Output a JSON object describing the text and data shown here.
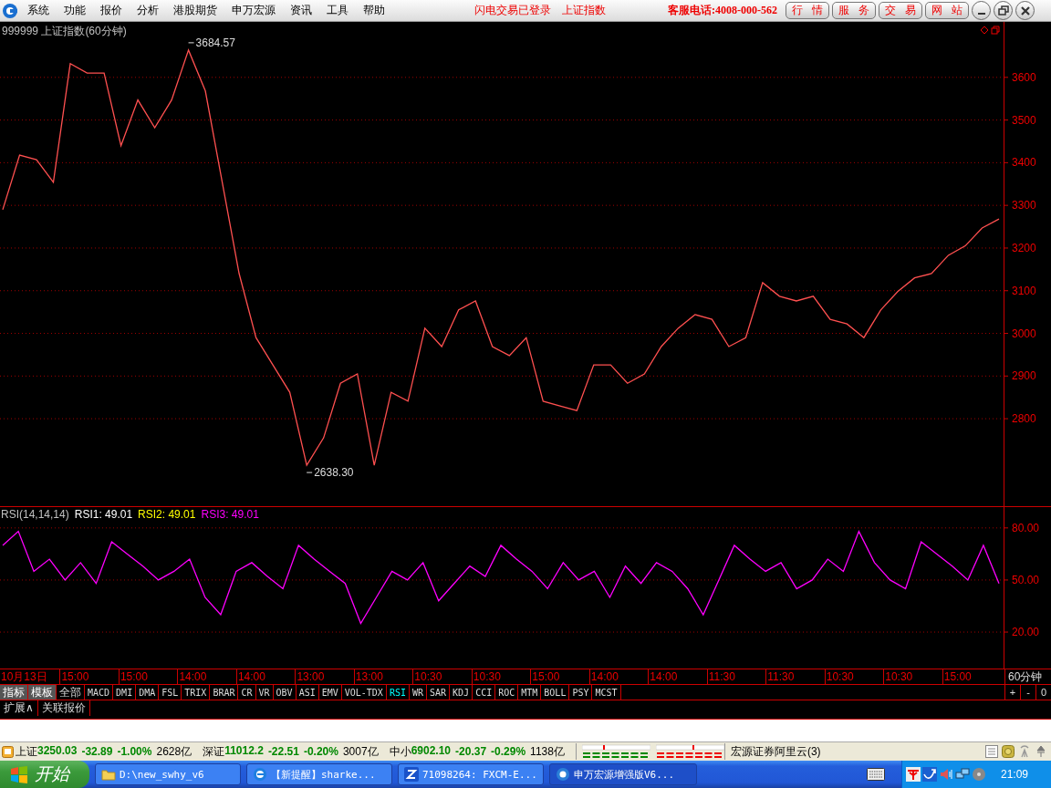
{
  "menu": {
    "items": [
      "系统",
      "功能",
      "报价",
      "分析",
      "港股期货",
      "申万宏源",
      "资讯",
      "工具",
      "帮助"
    ],
    "notice": "闪电交易已登录",
    "index_link": "上证指数",
    "hotline": "客服电话:4008-000-562",
    "buttons": [
      "行情",
      "服务",
      "交易",
      "网站"
    ]
  },
  "price_pane": {
    "title": "999999 上证指数(60分钟)",
    "chart_data": {
      "type": "line",
      "ylim": [
        2595,
        3730
      ],
      "grid": true,
      "yticks": [
        2800,
        2900,
        3000,
        3100,
        3200,
        3300,
        3400,
        3500,
        3600
      ],
      "series": [
        {
          "color": "#ff5050",
          "values": [
            3290,
            3418,
            3407,
            3354,
            3632,
            3610,
            3610,
            3440,
            3547,
            3482,
            3547,
            3664,
            3568,
            3354,
            3140,
            2990,
            2926,
            2862,
            2691,
            2755,
            2883,
            2905,
            2691,
            2862,
            2841,
            3012,
            2969,
            3055,
            3076,
            2969,
            2948,
            2990,
            2841,
            2830,
            2819,
            2926,
            2926,
            2883,
            2905,
            2969,
            3012,
            3044,
            3033,
            2969,
            2990,
            3119,
            3087,
            3076,
            3087,
            3033,
            3022,
            2990,
            3055,
            3098,
            3130,
            3140,
            3183,
            3205,
            3247,
            3268
          ]
        }
      ],
      "annotations": [
        {
          "text": "3684.57"
        },
        {
          "text": "2638.30"
        }
      ]
    }
  },
  "rsi_pane": {
    "legend": [
      {
        "text": "RSI(14,14,14)",
        "color": "#c0c0c0"
      },
      {
        "text": "RSI1: 49.01",
        "color": "#ffffff"
      },
      {
        "text": "RSI2: 49.01",
        "color": "#ffff00"
      },
      {
        "text": "RSI3: 49.01",
        "color": "#ff00ff"
      }
    ],
    "chart_data": {
      "type": "line",
      "ylim": [
        -1,
        92
      ],
      "grid": true,
      "yticks": [
        {
          "value": 20,
          "label": "20.00"
        },
        {
          "value": 50,
          "label": "50.00"
        },
        {
          "value": 80,
          "label": "80.00"
        }
      ],
      "series": [
        {
          "color": "#ff00ff",
          "values": [
            70,
            78,
            55,
            62,
            50,
            60,
            48,
            72,
            65,
            58,
            50,
            55,
            62,
            40,
            30,
            55,
            60,
            52,
            45,
            70,
            62,
            55,
            48,
            25,
            40,
            55,
            50,
            60,
            38,
            48,
            58,
            52,
            70,
            62,
            55,
            45,
            60,
            50,
            55,
            40,
            58,
            48,
            60,
            55,
            45,
            30,
            50,
            70,
            62,
            55,
            60,
            45,
            50,
            62,
            55,
            78,
            60,
            50,
            45,
            72,
            65,
            58,
            50,
            70,
            48
          ]
        }
      ]
    }
  },
  "time_axis": {
    "labels": [
      "10月13日",
      "15:00",
      "15:00",
      "14:00",
      "14:00",
      "13:00",
      "13:00",
      "10:30",
      "10:30",
      "15:00",
      "14:00",
      "14:00",
      "11:30",
      "11:30",
      "10:30",
      "10:30",
      "15:00"
    ],
    "period": "60分钟"
  },
  "indicator_tabs": [
    {
      "label": "指标",
      "kind": "mode",
      "selected": false
    },
    {
      "label": "模板",
      "kind": "mode",
      "selected": false
    },
    {
      "label": "全部",
      "kind": "indicator",
      "selected": false
    },
    {
      "label": "MACD",
      "kind": "indicator",
      "selected": false
    },
    {
      "label": "DMI",
      "kind": "indicator",
      "selected": false
    },
    {
      "label": "DMA",
      "kind": "indicator",
      "selected": false
    },
    {
      "label": "FSL",
      "kind": "indicator",
      "selected": false
    },
    {
      "label": "TRIX",
      "kind": "indicator",
      "selected": false
    },
    {
      "label": "BRAR",
      "kind": "indicator",
      "selected": false
    },
    {
      "label": "CR",
      "kind": "indicator",
      "selected": false
    },
    {
      "label": "VR",
      "kind": "indicator",
      "selected": false
    },
    {
      "label": "OBV",
      "kind": "indicator",
      "selected": false
    },
    {
      "label": "ASI",
      "kind": "indicator",
      "selected": false
    },
    {
      "label": "EMV",
      "kind": "indicator",
      "selected": false
    },
    {
      "label": "VOL-TDX",
      "kind": "indicator",
      "selected": false
    },
    {
      "label": "RSI",
      "kind": "indicator",
      "selected": true
    },
    {
      "label": "WR",
      "kind": "indicator",
      "selected": false
    },
    {
      "label": "SAR",
      "kind": "indicator",
      "selected": false
    },
    {
      "label": "KDJ",
      "kind": "indicator",
      "selected": false
    },
    {
      "label": "CCI",
      "kind": "indicator",
      "selected": false
    },
    {
      "label": "ROC",
      "kind": "indicator",
      "selected": false
    },
    {
      "label": "MTM",
      "kind": "indicator",
      "selected": false
    },
    {
      "label": "BOLL",
      "kind": "indicator",
      "selected": false
    },
    {
      "label": "PSY",
      "kind": "indicator",
      "selected": false
    },
    {
      "label": "MCST",
      "kind": "indicator",
      "selected": false
    }
  ],
  "zoom_buttons": [
    "+",
    "-",
    "0"
  ],
  "sub_tabs": [
    "扩展∧",
    "关联报价"
  ],
  "ticker": [
    {
      "name": "上证",
      "price": "3250.03",
      "change": "-32.89",
      "percent": "-1.00%",
      "turnover": "2628亿"
    },
    {
      "name": "深证",
      "price": "11012.2",
      "change": "-22.51",
      "percent": "-0.20%",
      "turnover": "3007亿"
    },
    {
      "name": "中小",
      "price": "6902.10",
      "change": "-20.37",
      "percent": "-0.29%",
      "turnover": "1138亿"
    }
  ],
  "server": "宏源证券阿里云(3)",
  "taskbar": {
    "start": "开始",
    "tasks": [
      {
        "label": "D:\\new_swhy_v6",
        "selected": false
      },
      {
        "label": "【新提醒】sharke...",
        "selected": false
      },
      {
        "label": "71098264: FXCM-E...",
        "selected": false
      },
      {
        "label": "申万宏源增强版V6...",
        "selected": true
      }
    ],
    "clock": "21:09"
  }
}
